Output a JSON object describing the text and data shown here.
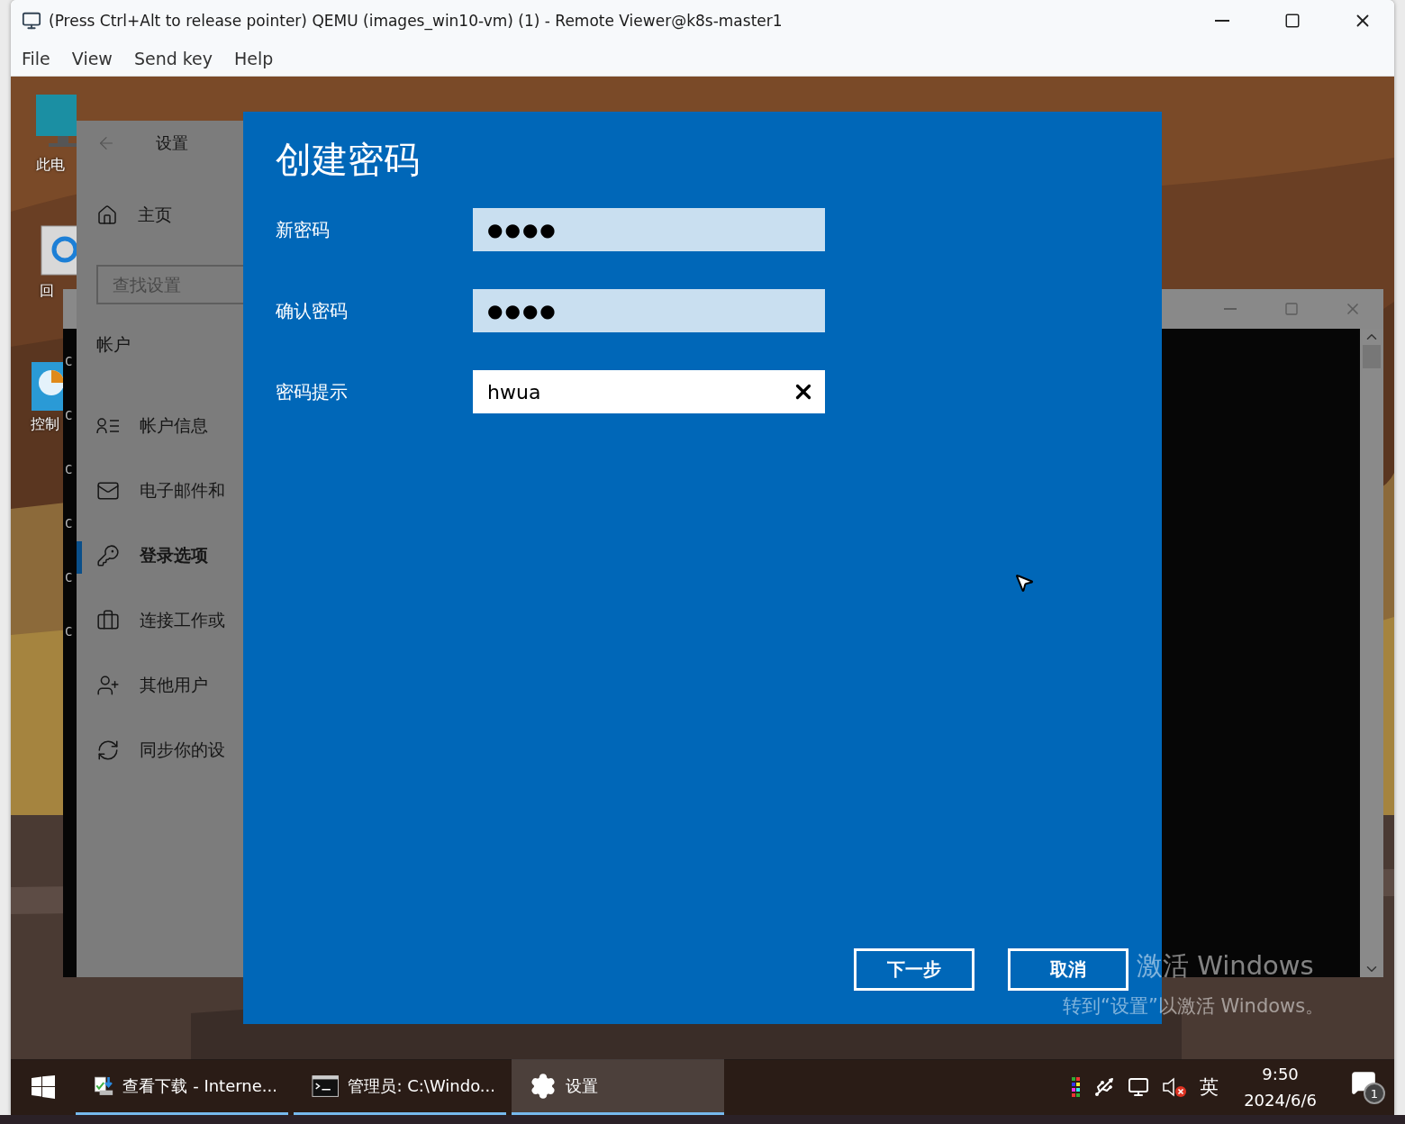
{
  "window": {
    "title": "(Press Ctrl+Alt to release pointer) QEMU (images_win10-vm) (1) - Remote Viewer@k8s-master1"
  },
  "menu": [
    "File",
    "View",
    "Send key",
    "Help"
  ],
  "desktop": {
    "icons": [
      {
        "label": "此电"
      },
      {
        "label": "回"
      },
      {
        "label": "控制"
      }
    ]
  },
  "console_window": {
    "lines": [
      "C",
      "C",
      "C",
      "C",
      "C",
      "C"
    ]
  },
  "settings_window": {
    "title": "设置",
    "home": "主页",
    "search": {
      "placeholder": "查找设置"
    },
    "section": "帐户",
    "nav": [
      {
        "label": "帐户信息",
        "selected": false
      },
      {
        "label": "电子邮件和",
        "selected": false
      },
      {
        "label": "登录选项",
        "selected": true
      },
      {
        "label": "连接工作或",
        "selected": false
      },
      {
        "label": "其他用户",
        "selected": false
      },
      {
        "label": "同步你的设",
        "selected": false
      }
    ]
  },
  "dialog": {
    "title": "创建密码",
    "fields": [
      {
        "label": "新密码",
        "kind": "password",
        "value": "●●●●"
      },
      {
        "label": "确认密码",
        "kind": "password",
        "value": "●●●●"
      },
      {
        "label": "密码提示",
        "kind": "text",
        "value": "hwua"
      }
    ],
    "buttons": [
      "下一步",
      "取消"
    ]
  },
  "activation": {
    "title": "激活 Windows",
    "text": "转到“设置”以激活 Windows。"
  },
  "taskbar": {
    "apps": [
      {
        "label": "查看下载 - Interne...",
        "kind": "download",
        "selected": false
      },
      {
        "label": "管理员: C:\\Windo...",
        "kind": "console",
        "selected": false
      },
      {
        "label": "设置",
        "kind": "settings",
        "selected": true
      }
    ],
    "tray": {
      "language": "英",
      "time": "9:50",
      "date": "2024/6/6",
      "notifications": "1"
    }
  }
}
